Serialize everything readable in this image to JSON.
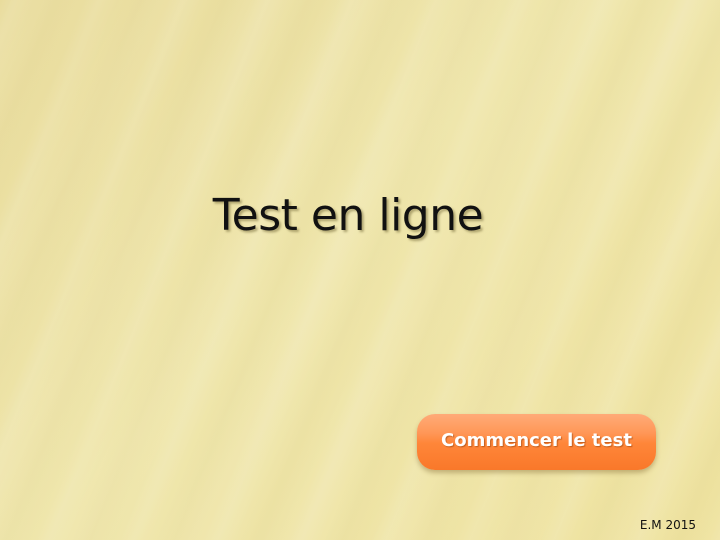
{
  "slide": {
    "title": "Test en ligne",
    "start_button_label": "Commencer le test",
    "credit": "E.M 2015"
  },
  "colors": {
    "background": "#ece3a6",
    "button_top": "#ffab78",
    "button_bottom": "#f9782a",
    "title_text": "#111111",
    "button_text": "#ffffff"
  }
}
